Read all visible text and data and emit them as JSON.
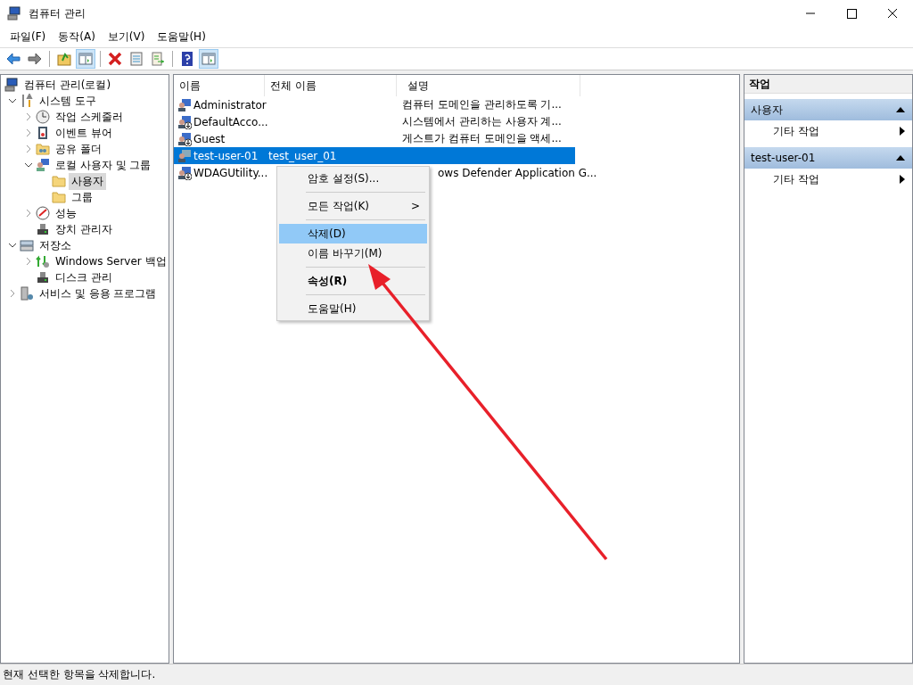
{
  "window": {
    "title": "컴퓨터 관리"
  },
  "menu_bar": [
    "파일(F)",
    "동작(A)",
    "보기(V)",
    "도움말(H)"
  ],
  "toolbar": {
    "groups": [
      [
        {
          "on": false
        },
        {
          "on": false
        }
      ],
      [
        {
          "on": false
        },
        {
          "on": true
        }
      ],
      [
        {
          "on": false
        },
        {
          "on": false
        },
        {
          "on": false
        }
      ],
      [
        {
          "on": false
        },
        {
          "on": true
        }
      ]
    ]
  },
  "tree": {
    "items": [
      {
        "label": "컴퓨터 관리(로컬)",
        "selected": false,
        "children": [
          {
            "label": "시스템 도구",
            "selected": false,
            "expanded": true,
            "children": [
              {
                "label": "작업 스케줄러",
                "selected": false,
                "expanded": false
              },
              {
                "label": "이벤트 뷰어",
                "selected": false,
                "expanded": false
              },
              {
                "label": "공유 폴더",
                "selected": false,
                "expanded": false
              },
              {
                "label": "로컬 사용자 및 그룹",
                "selected": false,
                "expanded": true,
                "children": [
                  {
                    "label": "사용자",
                    "selected": true
                  },
                  {
                    "label": "그룹",
                    "selected": false
                  }
                ]
              },
              {
                "label": "성능",
                "selected": false,
                "expanded": false
              },
              {
                "label": "장치 관리자",
                "selected": false
              }
            ]
          },
          {
            "label": "저장소",
            "selected": false,
            "expanded": true,
            "children": [
              {
                "label": "Windows Server 백업",
                "selected": false,
                "expanded": false
              },
              {
                "label": "디스크 관리",
                "selected": false
              }
            ]
          },
          {
            "label": "서비스 및 응용 프로그램",
            "selected": false,
            "expanded": false
          }
        ]
      }
    ]
  },
  "table": {
    "columns": [
      "이름",
      "전체 이름",
      "설명"
    ],
    "rows": [
      {
        "name": "Administrator",
        "full_name": "",
        "description": "컴퓨터 도메인을 관리하도록 기...",
        "disabled": false,
        "selected": false
      },
      {
        "name": "DefaultAcco...",
        "full_name": "",
        "description": "시스템에서 관리하는 사용자 계...",
        "disabled": true,
        "selected": false
      },
      {
        "name": "Guest",
        "full_name": "",
        "description": "게스트가 컴퓨터 도메인을 액세...",
        "disabled": true,
        "selected": false
      },
      {
        "name": "test-user-01",
        "full_name": "test_user_01",
        "description": "",
        "disabled": false,
        "selected": true
      },
      {
        "name": "WDAGUtility...",
        "full_name": "",
        "description": "ows Defender Application G...",
        "disabled": true,
        "selected": false
      }
    ]
  },
  "context_menu": {
    "groups": [
      [
        {
          "label": "암호 설정(S)...",
          "selected": false,
          "default": false
        }
      ],
      [
        {
          "label": "모든 작업(K)",
          "selected": false,
          "default": false,
          "arrow": ">"
        }
      ],
      [
        {
          "label": "삭제(D)",
          "selected": true,
          "default": false
        },
        {
          "label": "이름 바꾸기(M)",
          "selected": false,
          "default": false
        }
      ],
      [
        {
          "label": "속성(R)",
          "selected": false,
          "default": true
        }
      ],
      [
        {
          "label": "도움말(H)",
          "selected": false,
          "default": false
        }
      ]
    ]
  },
  "actions": {
    "title": "작업",
    "sections": [
      {
        "header": "사용자",
        "expanded": true,
        "items": [
          "기타 작업"
        ]
      },
      {
        "header": "test-user-01",
        "expanded": true,
        "items": [
          "기타 작업"
        ]
      }
    ]
  },
  "status_bar": "현재 선택한 항목을 삭제합니다."
}
